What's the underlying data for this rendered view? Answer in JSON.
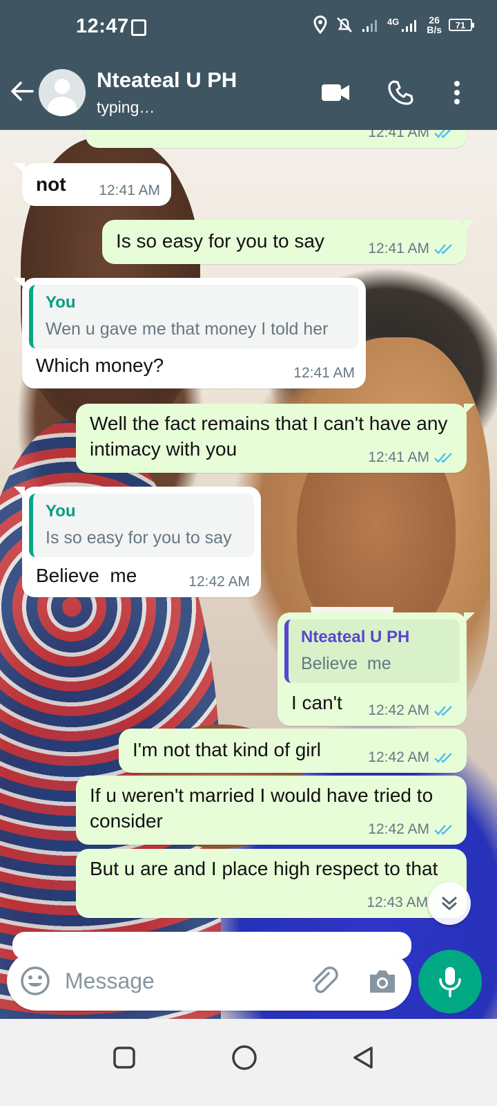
{
  "status_bar": {
    "time": "12:47",
    "network": "4G",
    "speed_value": "26",
    "speed_unit": "B/s",
    "battery": "71"
  },
  "header": {
    "contact_name": "Nteateal U PH",
    "contact_status": "typing…",
    "icons": [
      "back-arrow-icon",
      "avatar",
      "video-call-icon",
      "voice-call-icon",
      "more-options-icon"
    ]
  },
  "messages": [
    {
      "dir": "out",
      "text": "",
      "time": "12:41 AM",
      "partial": true
    },
    {
      "dir": "in",
      "text": "not",
      "time": "12:41 AM"
    },
    {
      "dir": "out",
      "text": "Is so easy for you to say",
      "time": "12:41 AM"
    },
    {
      "dir": "in",
      "quote_author": "You",
      "quote_text": "Wen u gave me that money I told her",
      "text": "Which money?",
      "time": "12:41 AM"
    },
    {
      "dir": "out",
      "text": "Well the fact remains that I can't have any intimacy with you",
      "time": "12:41 AM"
    },
    {
      "dir": "in",
      "quote_author": "You",
      "quote_text": "Is so easy for you to say",
      "text": "Believe  me",
      "time": "12:42 AM"
    },
    {
      "dir": "out",
      "quote_author": "Nteateal U PH",
      "quote_text": "Believe  me",
      "text": "I can't",
      "time": "12:42 AM"
    },
    {
      "dir": "out",
      "text": "I'm not that kind of girl",
      "time": "12:42 AM"
    },
    {
      "dir": "out",
      "text": "If u weren't married I would have tried to consider",
      "time": "12:42 AM"
    },
    {
      "dir": "out",
      "text": "But u are and I place high respect to that",
      "time": "12:43 AM"
    }
  ],
  "input": {
    "placeholder": "Message",
    "value": ""
  },
  "colors": {
    "header_bg": "#3f5562",
    "outgoing_bubble": "#e7fdd8",
    "incoming_bubble": "#ffffff",
    "accent_green": "#00a884",
    "read_tick_blue": "#53bdeb",
    "quote_you": "#069e7d",
    "quote_contact": "#5946d1"
  }
}
